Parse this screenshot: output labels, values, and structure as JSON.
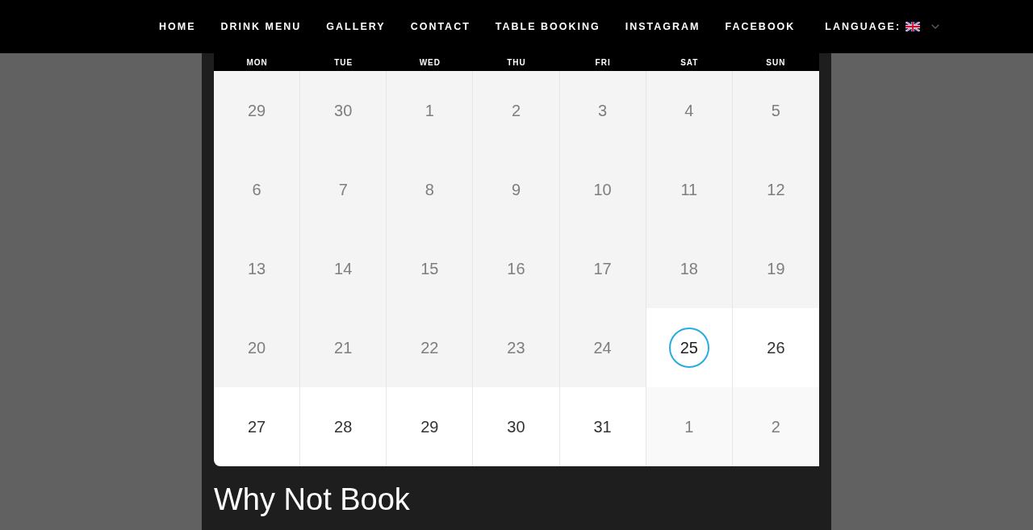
{
  "nav": {
    "items": [
      {
        "label": "HOME"
      },
      {
        "label": "DRINK MENU"
      },
      {
        "label": "GALLERY"
      },
      {
        "label": "CONTACT"
      },
      {
        "label": "TABLE BOOKING"
      },
      {
        "label": "INSTAGRAM"
      },
      {
        "label": "FACEBOOK"
      }
    ],
    "language": {
      "label": "LANGUAGE:"
    }
  },
  "calendar": {
    "weekdays": [
      "MON",
      "TUE",
      "WED",
      "THU",
      "FRI",
      "SAT",
      "SUN"
    ],
    "weeks": [
      [
        {
          "day": "29",
          "kind": "past"
        },
        {
          "day": "30",
          "kind": "past"
        },
        {
          "day": "1",
          "kind": "past"
        },
        {
          "day": "2",
          "kind": "past"
        },
        {
          "day": "3",
          "kind": "past"
        },
        {
          "day": "4",
          "kind": "past"
        },
        {
          "day": "5",
          "kind": "past"
        }
      ],
      [
        {
          "day": "6",
          "kind": "past"
        },
        {
          "day": "7",
          "kind": "past"
        },
        {
          "day": "8",
          "kind": "past"
        },
        {
          "day": "9",
          "kind": "past"
        },
        {
          "day": "10",
          "kind": "past"
        },
        {
          "day": "11",
          "kind": "past"
        },
        {
          "day": "12",
          "kind": "past"
        }
      ],
      [
        {
          "day": "13",
          "kind": "past"
        },
        {
          "day": "14",
          "kind": "past"
        },
        {
          "day": "15",
          "kind": "past"
        },
        {
          "day": "16",
          "kind": "past"
        },
        {
          "day": "17",
          "kind": "past"
        },
        {
          "day": "18",
          "kind": "past"
        },
        {
          "day": "19",
          "kind": "past"
        }
      ],
      [
        {
          "day": "20",
          "kind": "past"
        },
        {
          "day": "21",
          "kind": "past"
        },
        {
          "day": "22",
          "kind": "past"
        },
        {
          "day": "23",
          "kind": "past"
        },
        {
          "day": "24",
          "kind": "past"
        },
        {
          "day": "25",
          "kind": "today"
        },
        {
          "day": "26",
          "kind": "upcoming"
        }
      ],
      [
        {
          "day": "27",
          "kind": "upcoming"
        },
        {
          "day": "28",
          "kind": "upcoming"
        },
        {
          "day": "29",
          "kind": "upcoming"
        },
        {
          "day": "30",
          "kind": "upcoming"
        },
        {
          "day": "31",
          "kind": "upcoming"
        },
        {
          "day": "1",
          "kind": "next_month"
        },
        {
          "day": "2",
          "kind": "next_month"
        }
      ]
    ]
  },
  "heading": "Why Not Book"
}
